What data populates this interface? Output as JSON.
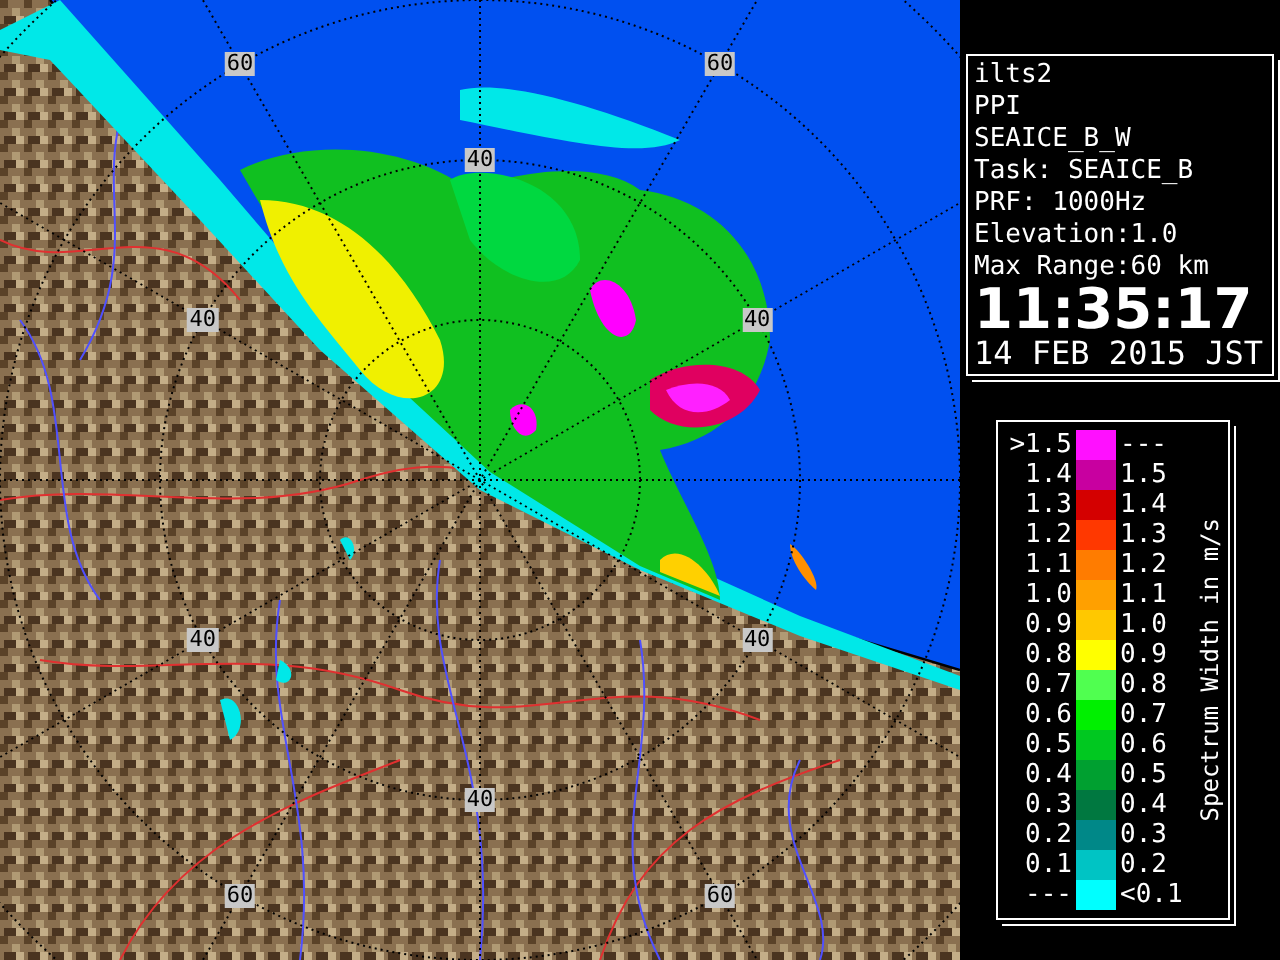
{
  "radar_map": {
    "range_labels": [
      "60",
      "60",
      "40",
      "40",
      "40",
      "40",
      "40",
      "40",
      "60",
      "60"
    ]
  },
  "info": {
    "lines": [
      "ilts2",
      "PPI",
      "SEAICE_B_W",
      "Task: SEAICE_B",
      "PRF: 1000Hz",
      "Elevation:1.0",
      "Max Range:60 km"
    ],
    "time": "11:35:17",
    "date": "14 FEB 2015 JST"
  },
  "legend": {
    "title": "Spectrum Width in m/s",
    "rows": [
      {
        "left_label": ">1.5",
        "right_label": "---",
        "color": "#ff10ff"
      },
      {
        "left_label": "1.4",
        "right_label": "1.5",
        "color": "#c800a0"
      },
      {
        "left_label": "1.3",
        "right_label": "1.4",
        "color": "#d40000"
      },
      {
        "left_label": "1.2",
        "right_label": "1.3",
        "color": "#ff3800"
      },
      {
        "left_label": "1.1",
        "right_label": "1.2",
        "color": "#ff7c00"
      },
      {
        "left_label": "1.0",
        "right_label": "1.1",
        "color": "#ffa000"
      },
      {
        "left_label": "0.9",
        "right_label": "1.0",
        "color": "#ffc800"
      },
      {
        "left_label": "0.8",
        "right_label": "0.9",
        "color": "#ffff00"
      },
      {
        "left_label": "0.7",
        "right_label": "0.8",
        "color": "#50ff50"
      },
      {
        "left_label": "0.6",
        "right_label": "0.7",
        "color": "#00f000"
      },
      {
        "left_label": "0.5",
        "right_label": "0.6",
        "color": "#00c820"
      },
      {
        "left_label": "0.4",
        "right_label": "0.5",
        "color": "#00a030"
      },
      {
        "left_label": "0.3",
        "right_label": "0.4",
        "color": "#007840"
      },
      {
        "left_label": "0.2",
        "right_label": "0.3",
        "color": "#008888"
      },
      {
        "left_label": "0.1",
        "right_label": "0.2",
        "color": "#00c4c4"
      },
      {
        "left_label": "---",
        "right_label": "<0.1",
        "color": "#00ffff"
      }
    ]
  }
}
